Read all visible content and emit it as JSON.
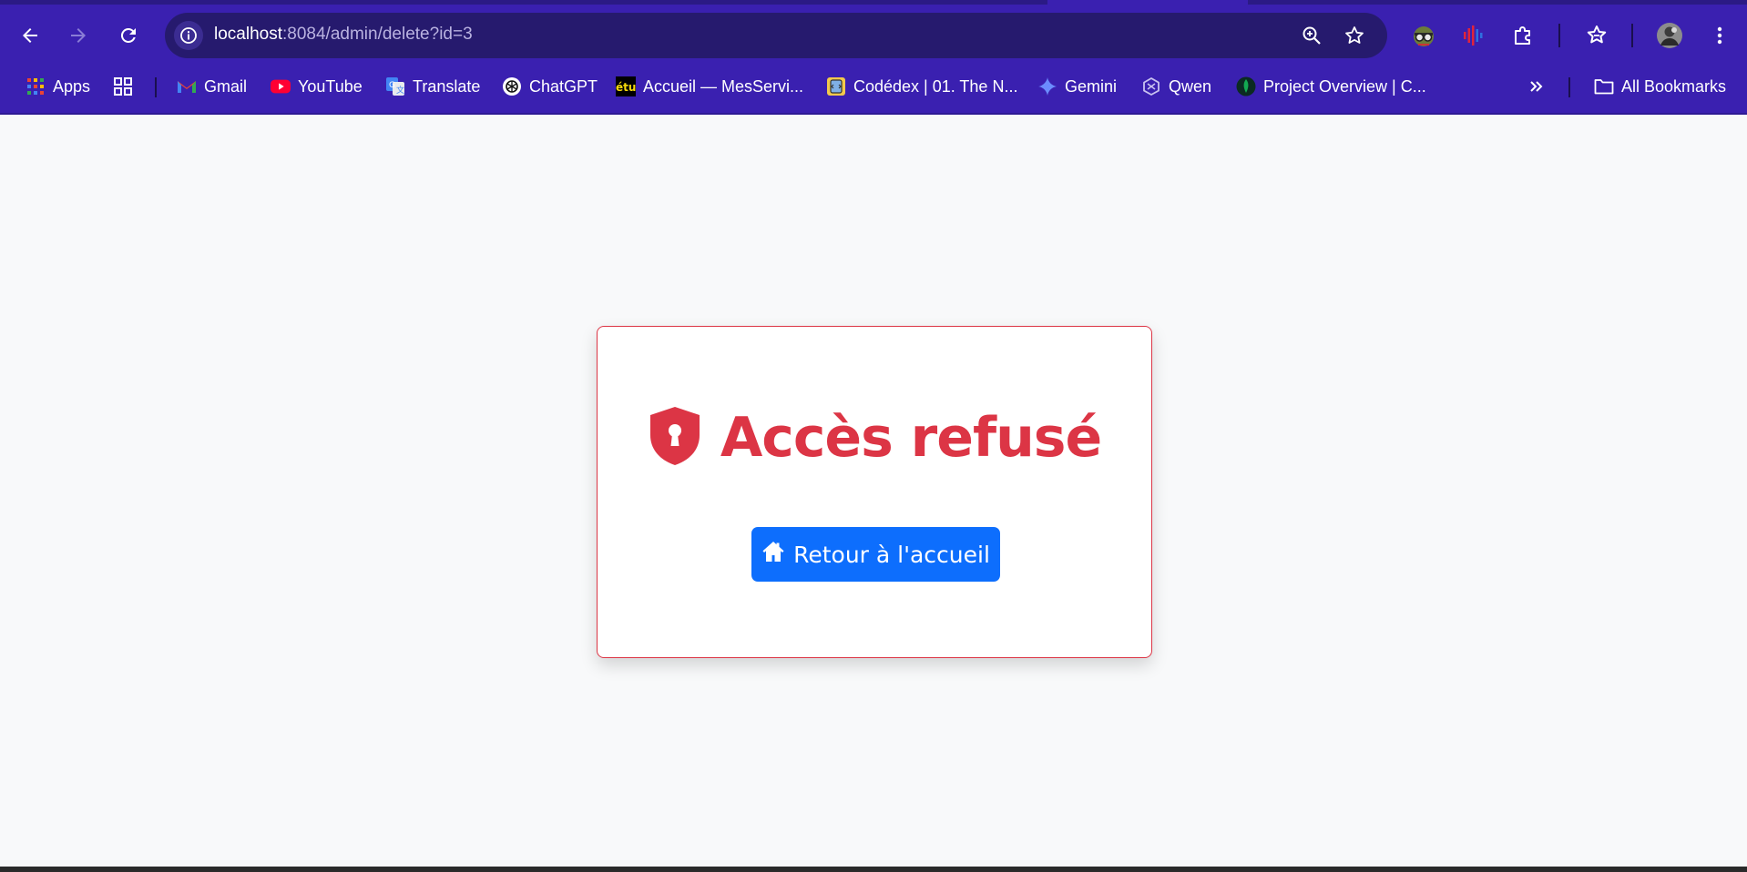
{
  "browser": {
    "url_host": "localhost",
    "url_path": ":8084/admin/delete?id=3",
    "bookmarks": [
      {
        "label": "Apps",
        "icon": "apps-grid-icon"
      },
      {
        "label": "",
        "icon": "tab-groups-icon"
      },
      {
        "label": "Gmail",
        "icon": "gmail-icon"
      },
      {
        "label": "YouTube",
        "icon": "youtube-icon"
      },
      {
        "label": "Translate",
        "icon": "translate-icon"
      },
      {
        "label": "ChatGPT",
        "icon": "chatgpt-icon"
      },
      {
        "label": "Accueil — MesServi...",
        "icon": "etu-icon"
      },
      {
        "label": "Codédex | 01. The N...",
        "icon": "codedex-icon"
      },
      {
        "label": "Gemini",
        "icon": "gemini-icon"
      },
      {
        "label": "Qwen",
        "icon": "qwen-icon"
      },
      {
        "label": "Project Overview | C...",
        "icon": "mongodb-icon"
      }
    ],
    "all_bookmarks_label": "All Bookmarks",
    "etu_icon_text": "étu",
    "colors": {
      "chrome": "#3a20b0",
      "omnibox": "#261a6e"
    }
  },
  "page": {
    "title": "Accès refusé",
    "title_icon": "shield-lock-icon",
    "home_button": "Retour à l'accueil",
    "home_icon": "house-icon",
    "colors": {
      "danger": "#dc3545",
      "primary": "#0d6efd",
      "background": "#f8f9fa"
    }
  }
}
